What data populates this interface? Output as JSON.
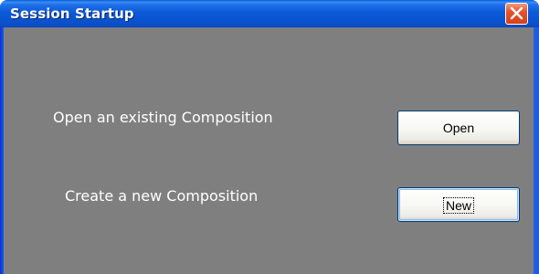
{
  "window": {
    "title": "Session Startup"
  },
  "titlebar": {
    "close_icon": "close-icon"
  },
  "dialog": {
    "open_prompt": "Open an existing Composition",
    "open_button_label": "Open",
    "new_prompt": "Create a new Composition",
    "new_button_label": "New"
  },
  "colors": {
    "titlebar_blue": "#0a54d2",
    "client_gray": "#7f7f7f",
    "close_red": "#e5532d"
  }
}
